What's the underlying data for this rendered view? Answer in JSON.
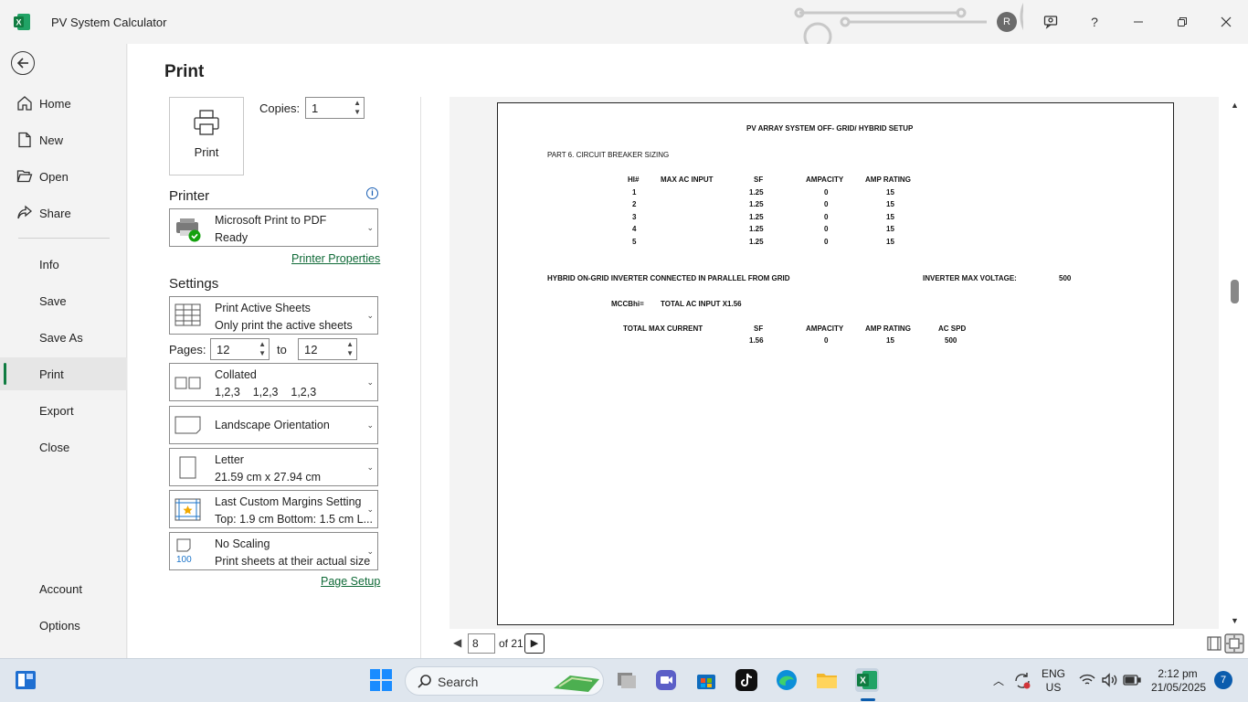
{
  "window": {
    "title": "PV System Calculator",
    "user_initial": "R"
  },
  "sidebar": {
    "items": [
      {
        "label": "Home",
        "icon": "home-icon"
      },
      {
        "label": "New",
        "icon": "new-document-icon"
      },
      {
        "label": "Open",
        "icon": "folder-open-icon"
      },
      {
        "label": "Share",
        "icon": "share-icon"
      },
      {
        "label": "Info"
      },
      {
        "label": "Save"
      },
      {
        "label": "Save As"
      },
      {
        "label": "Print",
        "active": true
      },
      {
        "label": "Export"
      },
      {
        "label": "Close"
      }
    ],
    "bottom": [
      {
        "label": "Account"
      },
      {
        "label": "Options"
      }
    ]
  },
  "print": {
    "heading": "Print",
    "print_button": "Print",
    "copies_label": "Copies:",
    "copies_value": "1",
    "printer_heading": "Printer",
    "printer_name": "Microsoft Print to PDF",
    "printer_status": "Ready",
    "printer_properties": "Printer Properties",
    "settings_heading": "Settings",
    "what": {
      "title": "Print Active Sheets",
      "subtitle": "Only print the active sheets"
    },
    "pages_label": "Pages:",
    "pages_from": "12",
    "pages_to_label": "to",
    "pages_to": "12",
    "collate": {
      "title": "Collated",
      "subtitle": "1,2,3    1,2,3    1,2,3"
    },
    "orientation": {
      "title": "Landscape Orientation"
    },
    "paper": {
      "title": "Letter",
      "subtitle": "21.59 cm x 27.94 cm"
    },
    "margins": {
      "title": "Last Custom Margins Setting",
      "subtitle": "Top: 1.9 cm Bottom: 1.5 cm L..."
    },
    "scaling": {
      "title": "No Scaling",
      "subtitle": "Print sheets at their actual size",
      "icon_text": "100"
    },
    "page_setup": "Page Setup"
  },
  "preview": {
    "title": "PV ARRAY SYSTEM OFF- GRID/ HYBRID SETUP",
    "part": "PART 6. CIRCUIT BREAKER SIZING",
    "table1": {
      "headers": [
        "HI#",
        "MAX AC INPUT",
        "SF",
        "AMPACITY",
        "AMP RATING"
      ],
      "rows": [
        [
          "1",
          "",
          "1.25",
          "0",
          "15"
        ],
        [
          "2",
          "",
          "1.25",
          "0",
          "15"
        ],
        [
          "3",
          "",
          "1.25",
          "0",
          "15"
        ],
        [
          "4",
          "",
          "1.25",
          "0",
          "15"
        ],
        [
          "5",
          "",
          "1.25",
          "0",
          "15"
        ]
      ]
    },
    "hybrid_label": "HYBRID ON-GRID INVERTER CONNECTED IN PARALLEL FROM GRID",
    "inverter_label": "INVERTER MAX VOLTAGE:",
    "inverter_value": "500",
    "mcc_label": "MCCBhi=",
    "mcc_formula": "TOTAL AC INPUT X1.56",
    "table2": {
      "headers": [
        "TOTAL MAX CURRENT",
        "SF",
        "AMPACITY",
        "AMP RATING",
        "AC SPD"
      ],
      "row": [
        "",
        "1.56",
        "0",
        "15",
        "500"
      ]
    },
    "current_page": "8",
    "of_pages": "of 21"
  },
  "taskbar": {
    "search_label": "Search",
    "lang_top": "ENG",
    "lang_bottom": "US",
    "time": "2:12 pm",
    "date": "21/05/2025",
    "notification_count": "7"
  }
}
